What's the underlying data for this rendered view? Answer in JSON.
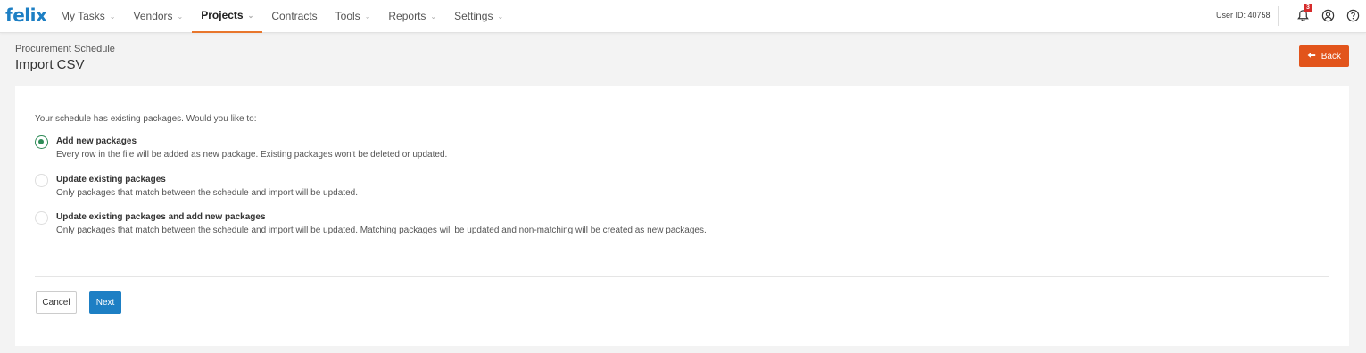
{
  "header": {
    "logo": "felix",
    "nav": [
      {
        "label": "My Tasks",
        "chevron": "chevron-down-icon"
      },
      {
        "label": "Vendors",
        "chevron": "chevron-down-icon"
      },
      {
        "label": "Projects",
        "chevron": "chevron-down-icon"
      },
      {
        "label": "Contracts"
      },
      {
        "label": "Tools",
        "chevron": "chevron-down-icon"
      },
      {
        "label": "Reports",
        "chevron": "chevron-down-icon"
      },
      {
        "label": "Settings",
        "chevron": "chevron-down-icon"
      }
    ],
    "active_nav": "Projects",
    "user_id": "User ID: 40758",
    "notification_count": "3"
  },
  "page": {
    "breadcrumb": "Procurement Schedule",
    "title": "Import CSV",
    "back_label": "Back"
  },
  "form": {
    "prompt": "Your schedule has existing packages. Would you like to:",
    "options": [
      {
        "label": "Add new packages",
        "description": "Every row in the file will be added as new package. Existing packages won't be deleted or updated.",
        "checked": true
      },
      {
        "label": "Update existing packages",
        "description": "Only packages that match between the schedule and import will be updated.",
        "checked": false
      },
      {
        "label": "Update existing packages and add new packages",
        "description": "Only packages that match between the schedule and import will be updated. Matching packages will be updated and non-matching will be created as new packages.",
        "checked": false
      }
    ],
    "cancel_label": "Cancel",
    "next_label": "Next"
  },
  "colors": {
    "brand": "#1d7fc4",
    "accent": "#e8762c",
    "back_button": "#e2541b",
    "radio_selected": "#2e8b57",
    "badge": "#d62b2b"
  }
}
